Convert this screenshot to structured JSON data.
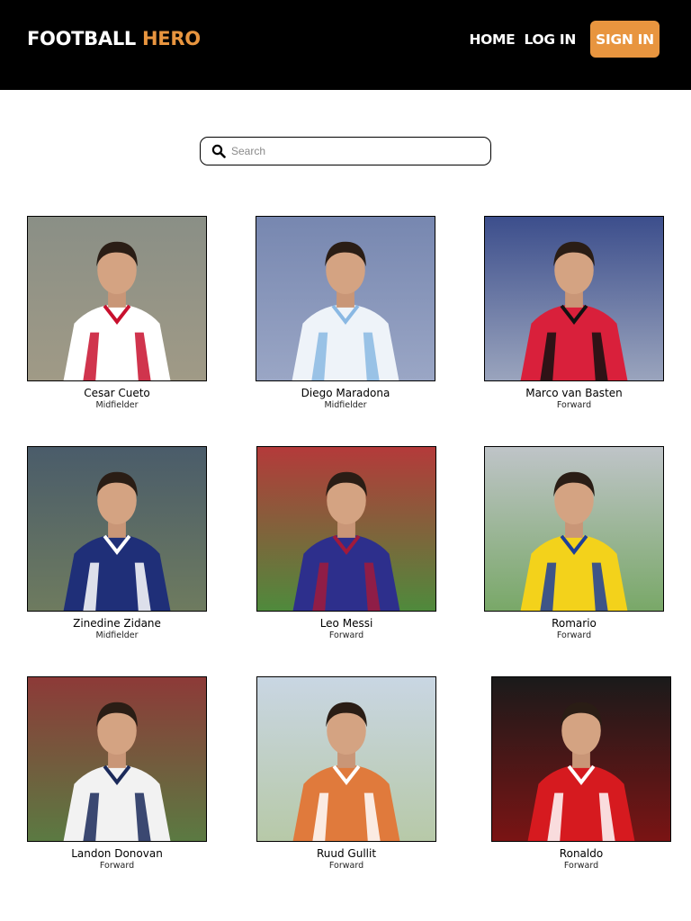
{
  "header": {
    "brand_main": "FOOTBALL",
    "brand_accent": "HERO",
    "nav": {
      "home": "HOME",
      "login": "LOG IN",
      "signin": "SIGN IN"
    },
    "colors": {
      "background": "#000000",
      "accent": "#e8953f",
      "text": "#ffffff"
    }
  },
  "search": {
    "placeholder": "Search",
    "value": "",
    "icon": "search-icon"
  },
  "players": [
    {
      "name": "Cesar Cueto",
      "position": "Midfielder",
      "kit": [
        "#ffffff",
        "#c8102e"
      ],
      "bg": [
        "#8a8f86",
        "#a09a86"
      ]
    },
    {
      "name": "Diego Maradona",
      "position": "Midfielder",
      "kit": [
        "#eef3f9",
        "#8ab8e3"
      ],
      "bg": [
        "#7787b0",
        "#9aa6c5"
      ]
    },
    {
      "name": "Marco van Basten",
      "position": "Forward",
      "kit": [
        "#d9203b",
        "#111111"
      ],
      "bg": [
        "#3c4e8c",
        "#9aa4bd"
      ]
    },
    {
      "name": "Zinedine Zidane",
      "position": "Midfielder",
      "kit": [
        "#1f2f78",
        "#ffffff"
      ],
      "bg": [
        "#4a5c6a",
        "#6e7b5f"
      ]
    },
    {
      "name": "Leo Messi",
      "position": "Forward",
      "kit": [
        "#2d2f8c",
        "#a11a3b"
      ],
      "bg": [
        "#b43a3a",
        "#4f8a3c"
      ]
    },
    {
      "name": "Romario",
      "position": "Forward",
      "kit": [
        "#f3d21b",
        "#1d3f9a"
      ],
      "bg": [
        "#bfc4c8",
        "#79a868"
      ]
    },
    {
      "name": "Landon Donovan",
      "position": "Forward",
      "kit": [
        "#f2f2f2",
        "#1b2a5a"
      ],
      "bg": [
        "#8d3a38",
        "#5b7a42"
      ]
    },
    {
      "name": "Ruud Gullit",
      "position": "Forward",
      "kit": [
        "#e07a3c",
        "#ffffff"
      ],
      "bg": [
        "#c9d6e3",
        "#b7c9a8"
      ]
    },
    {
      "name": "Ronaldo",
      "position": "Forward",
      "kit": [
        "#d61a1f",
        "#ffffff"
      ],
      "bg": [
        "#1a1a1a",
        "#7a1414"
      ]
    }
  ]
}
